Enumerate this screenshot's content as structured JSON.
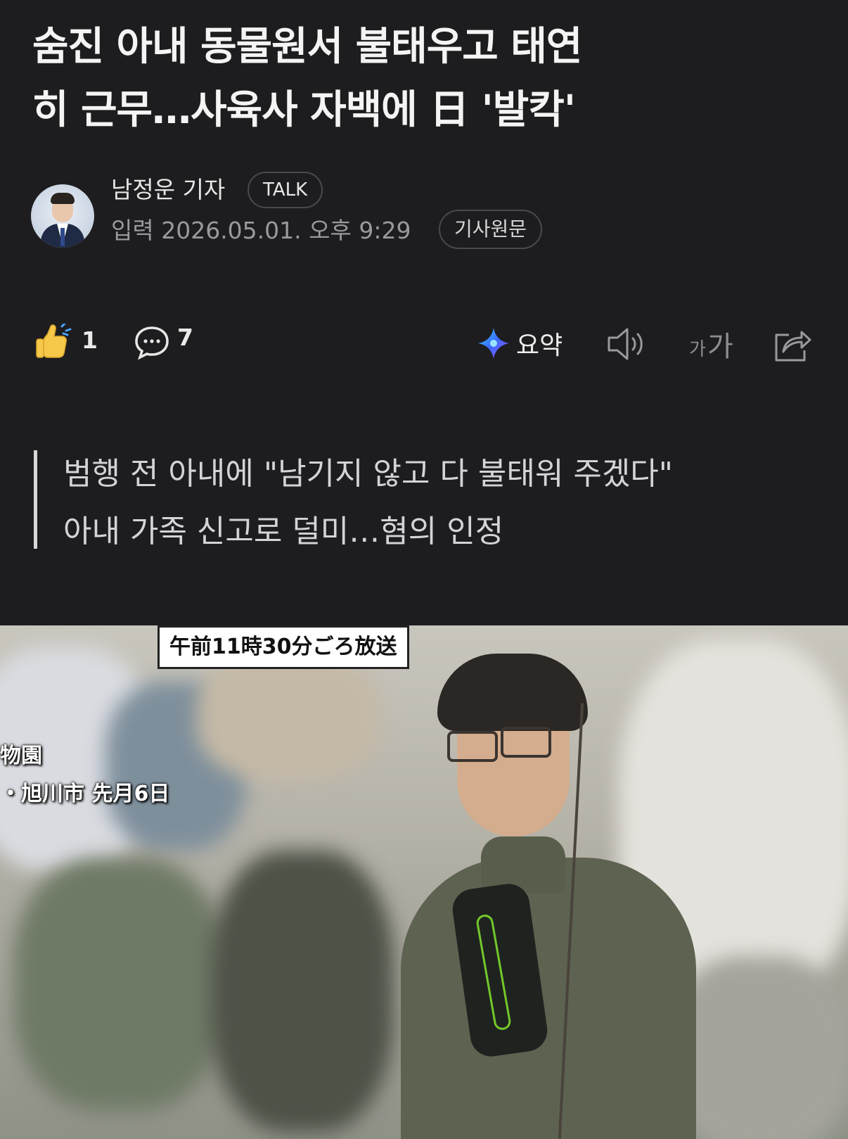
{
  "article": {
    "headline_line1": "숨진 아내 동물원서 불태우고 태연",
    "headline_line2": "히 근무…사육사 자백에 日 '발칵'",
    "reporter": "남정운 기자",
    "talk_label": "TALK",
    "published": "입력 2026.05.01. 오후 9:29",
    "source_label": "기사원문"
  },
  "actions": {
    "like_count": "1",
    "comment_count": "7",
    "summary_label": "요약",
    "font_small": "가",
    "font_big": "가"
  },
  "summary_lines": [
    "범행 전 아내에 \"남기지 않고 다 불태워 주겠다\"",
    "아내 가족 신고로 덜미…혐의 인정"
  ],
  "photo": {
    "broadcast_caption": "午前11時30分ごろ放送",
    "place_line1": "物園",
    "place_line2": "・旭川市 先月6日"
  },
  "colors": {
    "background": "#1d1d1f",
    "summary_icon_gradient": [
      "#3b6cff",
      "#a14cff",
      "#38d0ff"
    ]
  }
}
